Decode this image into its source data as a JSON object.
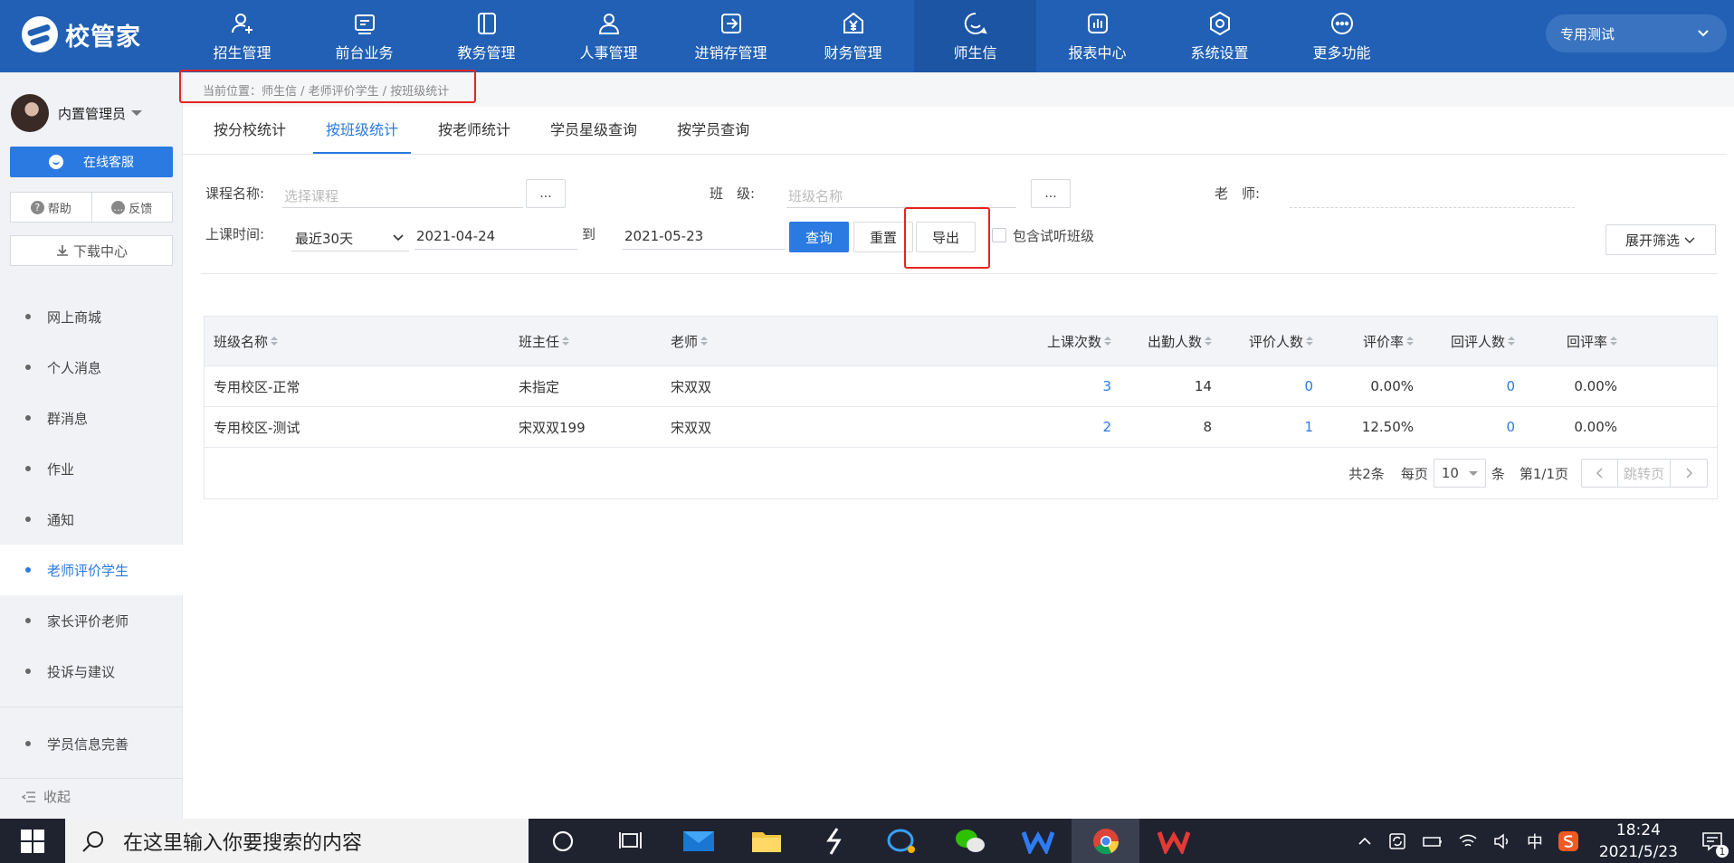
{
  "app": {
    "logo_text": "校管家"
  },
  "nav": [
    {
      "label": "招生管理",
      "icon": "user-plus-icon"
    },
    {
      "label": "前台业务",
      "icon": "reception-icon"
    },
    {
      "label": "教务管理",
      "icon": "book-icon"
    },
    {
      "label": "人事管理",
      "icon": "person-icon"
    },
    {
      "label": "进销存管理",
      "icon": "inventory-icon"
    },
    {
      "label": "财务管理",
      "icon": "yen-icon"
    },
    {
      "label": "师生信",
      "icon": "message-icon",
      "active": true
    },
    {
      "label": "报表中心",
      "icon": "report-icon"
    },
    {
      "label": "系统设置",
      "icon": "settings-icon"
    },
    {
      "label": "更多功能",
      "icon": "more-icon"
    }
  ],
  "org_select": {
    "value": "专用测试"
  },
  "sidebar": {
    "user_name": "内置管理员",
    "service_button": "在线客服",
    "help": "帮助",
    "feedback": "反馈",
    "download": "下载中心",
    "menu": [
      {
        "label": "网上商城"
      },
      {
        "label": "个人消息"
      },
      {
        "label": "群消息"
      },
      {
        "label": "作业"
      },
      {
        "label": "通知"
      },
      {
        "label": "老师评价学生",
        "active": true
      },
      {
        "label": "家长评价老师"
      },
      {
        "label": "投诉与建议"
      }
    ],
    "extra": "学员信息完善",
    "collapse": "收起"
  },
  "breadcrumb": "当前位置：师生信 / 老师评价学生 / 按班级统计",
  "tabs": [
    "按分校统计",
    "按班级统计",
    "按老师统计",
    "学员星级查询",
    "按学员查询"
  ],
  "active_tab": 1,
  "filters": {
    "course_label": "课程名称:",
    "course_placeholder": "选择课程",
    "class_label": "班　级:",
    "class_placeholder": "班级名称",
    "teacher_label": "老　师:",
    "dots": "...",
    "time_label": "上课时间:",
    "time_range": "最近30天",
    "date_from": "2021-04-24",
    "to_label": "到",
    "date_to": "2021-05-23",
    "query": "查询",
    "reset": "重置",
    "export": "导出",
    "include_trial": "包含试听班级",
    "expand": "展开筛选"
  },
  "table": {
    "headers": [
      "班级名称",
      "班主任",
      "老师",
      "上课次数",
      "出勤人数",
      "评价人数",
      "评价率",
      "回评人数",
      "回评率"
    ],
    "rows": [
      [
        "专用校区-正常",
        "未指定",
        "宋双双",
        "3",
        "14",
        "0",
        "0.00%",
        "0",
        "0.00%"
      ],
      [
        "专用校区-测试",
        "宋双双199",
        "宋双双",
        "2",
        "8",
        "1",
        "12.50%",
        "0",
        "0.00%"
      ]
    ]
  },
  "pager": {
    "total": "共2条",
    "per_page_label": "每页",
    "per_page": "10",
    "unit": "条",
    "page": "第1/1页",
    "jump": "跳转页"
  },
  "taskbar": {
    "search_placeholder": "在这里输入你要搜索的内容",
    "ime": "中",
    "time": "18:24",
    "date": "2021/5/23",
    "notif_count": "1"
  },
  "colors": {
    "nav_bg": "#2160b4",
    "accent": "#2a7ae2",
    "highlight": "#e52421"
  }
}
